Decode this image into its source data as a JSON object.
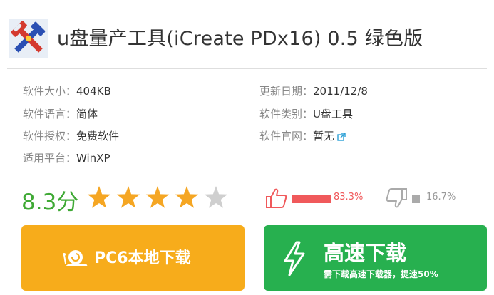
{
  "title": "u盘量产工具(iCreate PDx16) 0.5 绿色版",
  "info": {
    "size_label": "软件大小：",
    "size_value": "404KB",
    "date_label": "更新日期：",
    "date_value": "2011/12/8",
    "language_label": "软件语言：",
    "language_value": "简体",
    "category_label": "软件类别：",
    "category_value": "U盘工具",
    "license_label": "软件授权：",
    "license_value": "免费软件",
    "site_label": "软件官网：",
    "site_value": "暂无",
    "platform_label": "适用平台：",
    "platform_value": "WinXP"
  },
  "rating": {
    "score_text": "8.3分",
    "stars_filled": 4,
    "stars_total": 5,
    "star_color": "#f5a623",
    "star_empty_color": "#cfcfcf"
  },
  "votes": {
    "up_percent_text": "83.3%",
    "up_fraction": 0.833,
    "up_color": "#f0595b",
    "down_percent_text": "16.7%",
    "down_fraction": 0.167,
    "down_color": "#aaaaaa"
  },
  "buttons": {
    "local_label": "PC6本地下载",
    "local_color": "#f7ac1b",
    "fast_label": "高速下载",
    "fast_sub": "需下载高速下载器，提速50%",
    "fast_color": "#27b04f"
  },
  "icons": {
    "app": "tools-cross-icon",
    "external": "external-link-icon",
    "thumb_up": "thumb-up-icon",
    "thumb_down": "thumb-down-icon",
    "snail": "snail-icon",
    "bolt": "lightning-bolt-icon"
  }
}
